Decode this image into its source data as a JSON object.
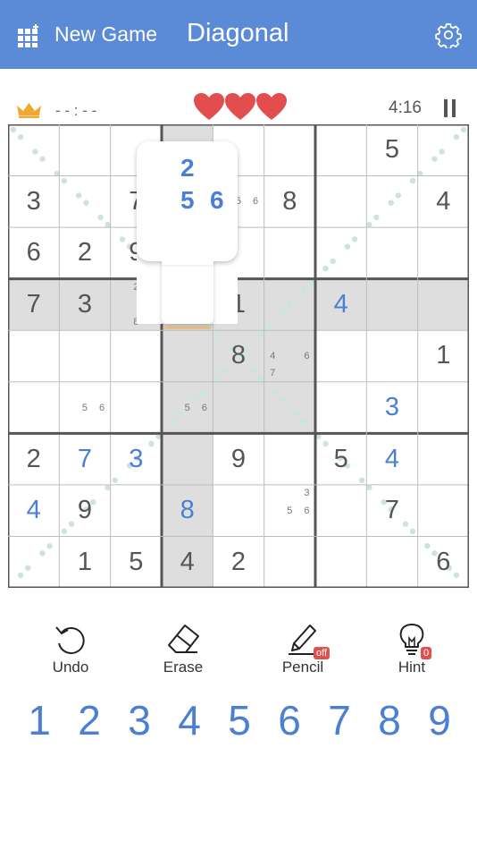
{
  "header": {
    "new_game_label": "New Game",
    "title": "Diagonal",
    "accent_color": "#5b8ad6",
    "icons": [
      "grid-plus-icon",
      "gear-icon"
    ]
  },
  "status": {
    "best_time": "- - : - -",
    "lives": 3,
    "timer": "4:16",
    "icons": [
      "crown-icon",
      "heart-icon",
      "pause-icon"
    ]
  },
  "board": {
    "size": 9,
    "givens": [
      [
        null,
        null,
        null,
        null,
        null,
        null,
        null,
        "5",
        null
      ],
      [
        "3",
        null,
        "7",
        null,
        null,
        "8",
        null,
        null,
        "4"
      ],
      [
        "6",
        "2",
        "9",
        null,
        null,
        null,
        null,
        null,
        null
      ],
      [
        "7",
        "3",
        null,
        null,
        "1",
        null,
        null,
        null,
        null
      ],
      [
        null,
        null,
        null,
        null,
        "8",
        null,
        null,
        null,
        "1"
      ],
      [
        null,
        null,
        null,
        null,
        null,
        null,
        null,
        null,
        null
      ],
      [
        "2",
        null,
        null,
        null,
        "9",
        null,
        "5",
        null,
        null
      ],
      [
        null,
        "9",
        null,
        null,
        null,
        null,
        null,
        "7",
        null
      ],
      [
        null,
        "1",
        "5",
        "4",
        "2",
        null,
        null,
        null,
        "6"
      ]
    ],
    "user_entries": [
      [
        null,
        null,
        null,
        null,
        null,
        null,
        null,
        null,
        null
      ],
      [
        null,
        null,
        null,
        null,
        null,
        null,
        null,
        null,
        null
      ],
      [
        null,
        null,
        null,
        null,
        null,
        null,
        null,
        null,
        null
      ],
      [
        null,
        null,
        null,
        null,
        null,
        null,
        "4",
        null,
        null
      ],
      [
        null,
        null,
        null,
        null,
        null,
        null,
        null,
        null,
        null
      ],
      [
        null,
        null,
        null,
        null,
        null,
        null,
        null,
        "3",
        null
      ],
      [
        null,
        "7",
        "3",
        null,
        null,
        null,
        null,
        "4",
        null
      ],
      [
        "4",
        null,
        null,
        "8",
        null,
        null,
        null,
        null,
        null
      ],
      [
        null,
        null,
        null,
        null,
        null,
        null,
        null,
        null,
        null
      ]
    ],
    "notes": [
      {
        "row": 1,
        "col": 4,
        "digits": [
          "5",
          "6"
        ]
      },
      {
        "row": 3,
        "col": 2,
        "digits": [
          "2",
          "6",
          "8"
        ]
      },
      {
        "row": 4,
        "col": 5,
        "digits": [
          "4",
          "6",
          "7"
        ]
      },
      {
        "row": 5,
        "col": 1,
        "digits": [
          "5",
          "6"
        ]
      },
      {
        "row": 5,
        "col": 3,
        "digits": [
          "5",
          "6"
        ]
      },
      {
        "row": 7,
        "col": 5,
        "digits": [
          "3",
          "5",
          "6"
        ]
      }
    ],
    "selected": {
      "row": 3,
      "col": 3
    },
    "highlight_color": "#dedede",
    "diagonal_dot_color": "#cde3e0"
  },
  "popup": {
    "top": "2",
    "middle": [
      "5",
      "6"
    ]
  },
  "controls": {
    "undo_label": "Undo",
    "erase_label": "Erase",
    "pencil_label": "Pencil",
    "pencil_badge": "off",
    "hint_label": "Hint",
    "hint_badge": "0"
  },
  "numpad": [
    "1",
    "2",
    "3",
    "4",
    "5",
    "6",
    "7",
    "8",
    "9"
  ]
}
